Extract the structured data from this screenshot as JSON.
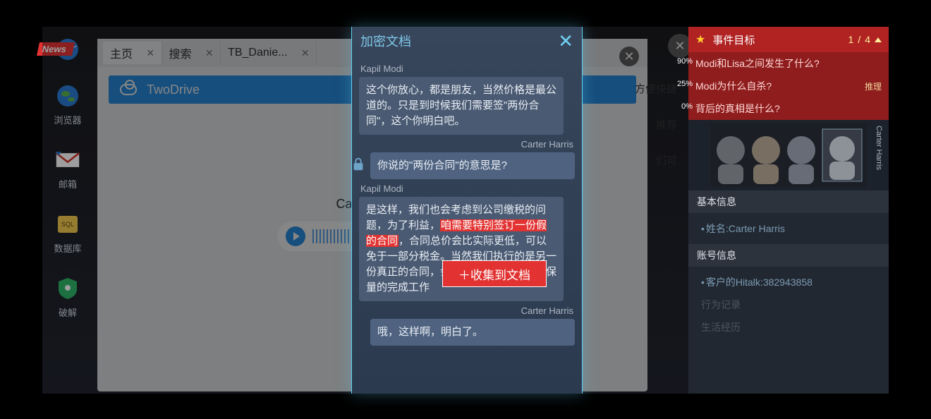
{
  "dock": {
    "news_badge": "News",
    "items": [
      {
        "label": "浏览器"
      },
      {
        "label": "邮箱"
      },
      {
        "label": "数据库"
      },
      {
        "label": "破解"
      }
    ]
  },
  "browser": {
    "tabs": [
      {
        "label": "主页"
      },
      {
        "label": "搜索"
      },
      {
        "label": "TB_Danie..."
      }
    ],
    "address": "TwoDrive",
    "body_title_prefix": "Carter Harris"
  },
  "bg_right": {
    "line1": "方便快捷",
    "line2": "推荐",
    "line3": "们可"
  },
  "chat": {
    "title": "加密文档",
    "messages": [
      {
        "sender": "Kapil Modi",
        "side": "left",
        "text": "这个你放心，都是朋友，当然价格是最公道的。只是到时候我们需要签\"两份合同\"，这个你明白吧。"
      },
      {
        "sender": "Carter Harris",
        "side": "right",
        "text": "你说的\"两份合同\"的意思是?",
        "lock": true
      },
      {
        "sender": "Kapil Modi",
        "side": "left",
        "text_pre": "是这样，我们也会考虑到公司缴税的问题，为了利益，",
        "text_hl": "咱需要特别签订一份假的合同",
        "text_post": "，合同总价会比实际更低，可以免于一部分税金。当然我们执行的是另一份真正的合同，会按照实际的合同保质保量的完成工作"
      },
      {
        "sender": "Carter Harris",
        "side": "right",
        "text": "哦，这样啊，明白了。"
      }
    ],
    "collect_btn": "＋收集到文档"
  },
  "goals": {
    "header": "事件目标",
    "count_cur": "1",
    "count_total": "4",
    "items": [
      {
        "text": "Modi和Lisa之间发生了什么?",
        "pct": "90%"
      },
      {
        "text": "Modi为什么自杀?",
        "pct": "25%",
        "tag": "推理"
      },
      {
        "text": "背后的真相是什么?",
        "pct": "0%"
      }
    ],
    "avatar_label": "Carter Harris",
    "sections": {
      "basic_title": "基本信息",
      "name_label": "姓名:",
      "name_value": "Carter Harris",
      "account_title": "账号信息",
      "account_label": "客户的Hitalk:",
      "account_value": "382943858",
      "dim1": "行为记录",
      "dim2": "生活经历"
    }
  }
}
